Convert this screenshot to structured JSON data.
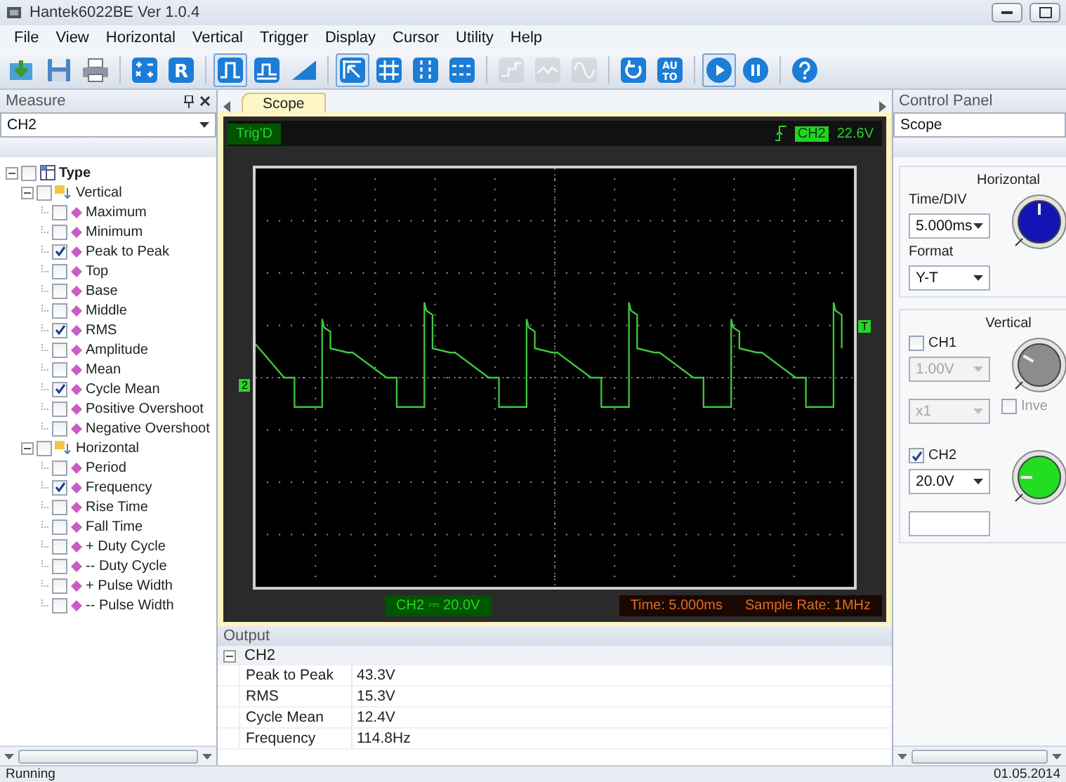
{
  "window": {
    "title": "Hantek6022BE Ver 1.0.4"
  },
  "menu": [
    "File",
    "View",
    "Horizontal",
    "Vertical",
    "Trigger",
    "Display",
    "Cursor",
    "Utility",
    "Help"
  ],
  "toolbar": [
    {
      "kind": "open",
      "selected": false,
      "disabled": false
    },
    {
      "kind": "save",
      "selected": false,
      "disabled": false
    },
    {
      "kind": "print",
      "selected": false,
      "disabled": false
    },
    {
      "kind": "separator"
    },
    {
      "kind": "math",
      "selected": false,
      "disabled": false
    },
    {
      "kind": "letter",
      "label": "R",
      "selected": false,
      "disabled": false
    },
    {
      "kind": "separator"
    },
    {
      "kind": "pulse",
      "selected": true,
      "disabled": false
    },
    {
      "kind": "pulse-small",
      "selected": false,
      "disabled": false
    },
    {
      "kind": "ramp",
      "selected": false,
      "disabled": false
    },
    {
      "kind": "separator"
    },
    {
      "kind": "pointer",
      "selected": true,
      "disabled": false
    },
    {
      "kind": "cross-cursor",
      "selected": false,
      "disabled": false
    },
    {
      "kind": "vertical-cursor",
      "selected": false,
      "disabled": false
    },
    {
      "kind": "horizontal-cursor",
      "selected": false,
      "disabled": false
    },
    {
      "kind": "separator"
    },
    {
      "kind": "step",
      "selected": false,
      "disabled": true
    },
    {
      "kind": "zigzag",
      "selected": false,
      "disabled": true
    },
    {
      "kind": "sine",
      "selected": false,
      "disabled": true
    },
    {
      "kind": "separator"
    },
    {
      "kind": "refresh",
      "selected": false,
      "disabled": false
    },
    {
      "kind": "letter",
      "label": "AU TO",
      "selected": false,
      "disabled": false
    },
    {
      "kind": "separator"
    },
    {
      "kind": "play",
      "selected": true,
      "disabled": false
    },
    {
      "kind": "pause",
      "selected": false,
      "disabled": false
    },
    {
      "kind": "separator"
    },
    {
      "kind": "help",
      "selected": false,
      "disabled": false
    }
  ],
  "measure_panel": {
    "title": "Measure",
    "channel": "CH2",
    "tree": {
      "label": "Type",
      "checked": false,
      "expanded": true,
      "children": [
        {
          "label": "Vertical",
          "checked": false,
          "expanded": true,
          "children": [
            {
              "label": "Maximum",
              "checked": false
            },
            {
              "label": "Minimum",
              "checked": false
            },
            {
              "label": "Peak to Peak",
              "checked": true
            },
            {
              "label": "Top",
              "checked": false
            },
            {
              "label": "Base",
              "checked": false
            },
            {
              "label": "Middle",
              "checked": false
            },
            {
              "label": "RMS",
              "checked": true
            },
            {
              "label": "Amplitude",
              "checked": false
            },
            {
              "label": "Mean",
              "checked": false
            },
            {
              "label": "Cycle Mean",
              "checked": true
            },
            {
              "label": "Positive Overshoot",
              "checked": false
            },
            {
              "label": "Negative Overshoot",
              "checked": false
            }
          ]
        },
        {
          "label": "Horizontal",
          "checked": false,
          "expanded": true,
          "children": [
            {
              "label": "Period",
              "checked": false
            },
            {
              "label": "Frequency",
              "checked": true
            },
            {
              "label": "Rise Time",
              "checked": false
            },
            {
              "label": "Fall Time",
              "checked": false
            },
            {
              "label": "+ Duty Cycle",
              "checked": false
            },
            {
              "label": "-- Duty Cycle",
              "checked": false
            },
            {
              "label": "+ Pulse Width",
              "checked": false
            },
            {
              "label": "-- Pulse Width",
              "checked": false
            }
          ]
        }
      ]
    }
  },
  "tabs": [
    {
      "label": "Scope",
      "selected": true
    }
  ],
  "scope": {
    "trigger_status": "Trig'D",
    "trigger_source": "CH2",
    "trigger_level": "22.6V",
    "channel_marker": "2",
    "trigger_marker": "T",
    "channel_readout": "CH2 ⎓ 20.0V",
    "time": "Time: 5.000ms",
    "sample_rate": "Sample Rate: 1MHz"
  },
  "output": {
    "title": "Output",
    "group": "CH2",
    "expanded": true,
    "rows": [
      {
        "name": "Peak to Peak",
        "value": "43.3V"
      },
      {
        "name": "RMS",
        "value": "15.3V"
      },
      {
        "name": "Cycle Mean",
        "value": "12.4V"
      },
      {
        "name": "Frequency",
        "value": "114.8Hz"
      }
    ]
  },
  "control_panel": {
    "title": "Control Panel",
    "mode": "Scope",
    "horizontal": {
      "title": "Horizontal",
      "time_div_label": "Time/DIV",
      "time_div": "5.000ms",
      "format_label": "Format",
      "format": "Y-T"
    },
    "vertical": {
      "title": "Vertical",
      "channels": [
        {
          "label": "CH1",
          "checked": false,
          "volts": "1.00V",
          "probe": "x1",
          "invert_label": "Inve",
          "invert_checked": false,
          "color": "#8c8c8c"
        },
        {
          "label": "CH2",
          "checked": true,
          "volts": "20.0V",
          "color": "#22dd22"
        }
      ]
    }
  },
  "status_bar": {
    "status": "Running",
    "date": "01.05.2014"
  }
}
